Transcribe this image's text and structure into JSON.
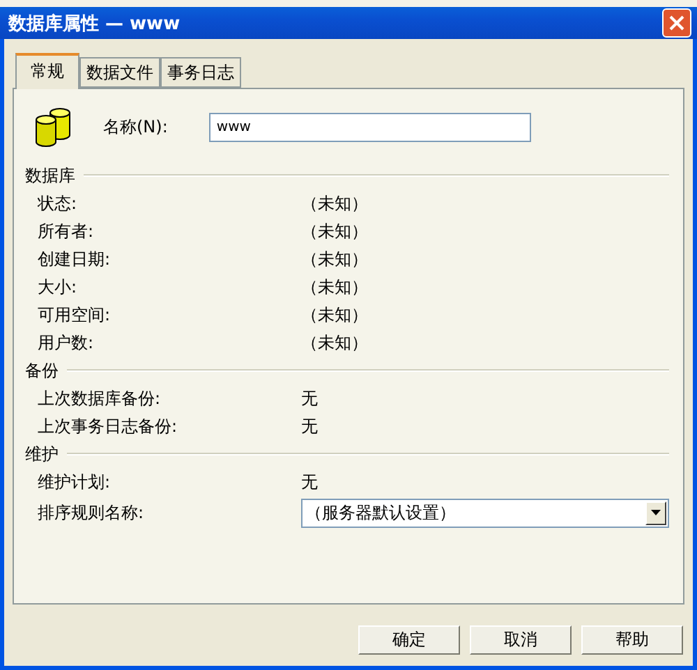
{
  "window": {
    "title": "数据库属性 — www"
  },
  "tabs": [
    {
      "label": "常规",
      "selected": true
    },
    {
      "label": "数据文件",
      "selected": false
    },
    {
      "label": "事务日志",
      "selected": false
    }
  ],
  "name_field": {
    "label": "名称(N):",
    "value": "www"
  },
  "sections": [
    {
      "title": "数据库",
      "rows": [
        {
          "kind": "text",
          "label": "状态:",
          "value": "（未知）"
        },
        {
          "kind": "text",
          "label": "所有者:",
          "value": "（未知）"
        },
        {
          "kind": "text",
          "label": "创建日期:",
          "value": "（未知）"
        },
        {
          "kind": "text",
          "label": "大小:",
          "value": "（未知）"
        },
        {
          "kind": "text",
          "label": "可用空间:",
          "value": "（未知）"
        },
        {
          "kind": "text",
          "label": "用户数:",
          "value": "（未知）"
        }
      ]
    },
    {
      "title": "备份",
      "rows": [
        {
          "kind": "text",
          "label": "上次数据库备份:",
          "value": "无"
        },
        {
          "kind": "text",
          "label": "上次事务日志备份:",
          "value": "无"
        }
      ]
    },
    {
      "title": "维护",
      "rows": [
        {
          "kind": "text",
          "label": "维护计划:",
          "value": "无"
        },
        {
          "kind": "combo",
          "label": "排序规则名称:",
          "value": "（服务器默认设置）"
        }
      ]
    }
  ],
  "buttons": [
    "确定",
    "取消",
    "帮助"
  ]
}
